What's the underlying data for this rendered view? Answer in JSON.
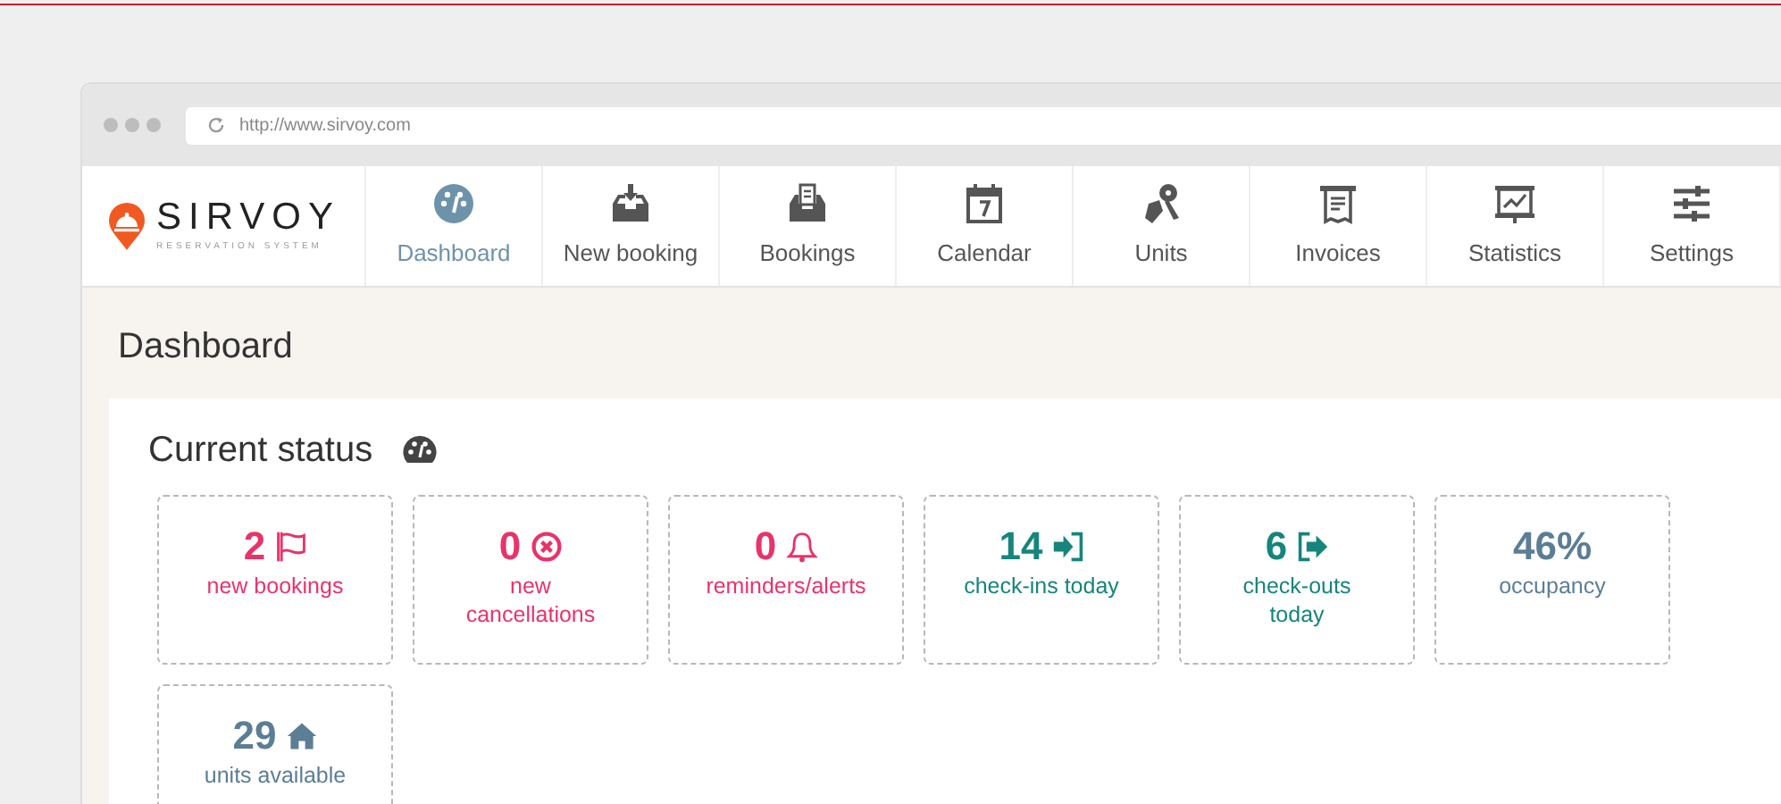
{
  "browser": {
    "url": "http://www.sirvoy.com"
  },
  "logo": {
    "name": "SIRVOY",
    "tagline": "RESERVATION SYSTEM"
  },
  "nav": [
    {
      "label": "Dashboard",
      "selected": true
    },
    {
      "label": "New booking",
      "selected": false
    },
    {
      "label": "Bookings",
      "selected": false
    },
    {
      "label": "Calendar",
      "selected": false
    },
    {
      "label": "Units",
      "selected": false
    },
    {
      "label": "Invoices",
      "selected": false
    },
    {
      "label": "Statistics",
      "selected": false
    },
    {
      "label": "Settings",
      "selected": false
    }
  ],
  "page_title": "Dashboard",
  "status": {
    "title": "Current status",
    "tiles": [
      {
        "value": "2",
        "label": "new bookings",
        "color": "#e8336b"
      },
      {
        "value": "0",
        "label": "new cancellations",
        "color": "#e8336b"
      },
      {
        "value": "0",
        "label": "reminders/alerts",
        "color": "#e8336b"
      },
      {
        "value": "14",
        "label": "check-ins today",
        "color": "#16857b"
      },
      {
        "value": "6",
        "label": "check-outs today",
        "color": "#16857b"
      },
      {
        "value": "46%",
        "label": "occupancy",
        "color": "#5b7e94"
      },
      {
        "value": "29",
        "label": "units available",
        "color": "#5b7e94"
      }
    ]
  }
}
